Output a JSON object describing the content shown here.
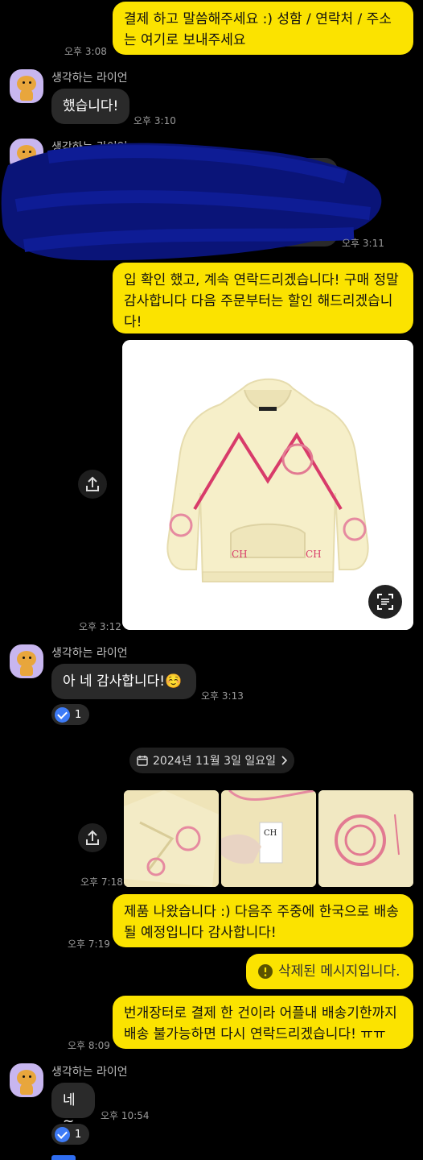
{
  "chat": {
    "contact_name": "생각하는 라이언",
    "messages": {
      "m1": {
        "text": "결제 하고 말씀해주세요 :) 성함 / 연락처 / 주소는 여기로 보내주세요",
        "time": "오후 3:08"
      },
      "m2": {
        "text": "했습니다!",
        "time": "오후 3:10"
      },
      "m3": {
        "time": "오후 3:11"
      },
      "m4": {
        "text": "입 확인 했고, 계속 연락드리겠습니다! 구매 정말 감사합니다 다음 주문부터는 할인 해드리겠습니다!"
      },
      "m5": {
        "time": "오후 3:12"
      },
      "m6": {
        "text": "아 네 감사합니다!☺️",
        "time": "오후 3:13",
        "reaction_count": "1"
      },
      "m7": {
        "time": "오후 7:18"
      },
      "m8": {
        "text": "제품 나왔습니다 :) 다음주 주중에 한국으로 배송 될 예정입니다 감사합니다!",
        "time": "오후 7:19"
      },
      "m9": {
        "text": "삭제된 메시지입니다."
      },
      "m10": {
        "text": "번개장터로 결제 한 건이라 어플내 배송기한까지 배송 불가능하면 다시 연락드리겠습니다! ㅠㅠ",
        "time": "오후 8:09"
      },
      "m11": {
        "text": "네~",
        "time": "오후 10:54",
        "reaction_count": "1"
      }
    },
    "date_divider": "2024년 11월 3일 일요일"
  },
  "colors": {
    "my_bubble": "#fbe300",
    "other_bubble": "#2a2a2a",
    "background": "#000000",
    "scribble": "#0a1478",
    "reaction_check": "#3d7bf7"
  },
  "icons": {
    "share": "share-icon",
    "scan": "scan-text-icon",
    "calendar": "calendar-icon",
    "chevron": "chevron-right-icon",
    "warning": "warning-icon",
    "check": "check-circle-icon"
  }
}
